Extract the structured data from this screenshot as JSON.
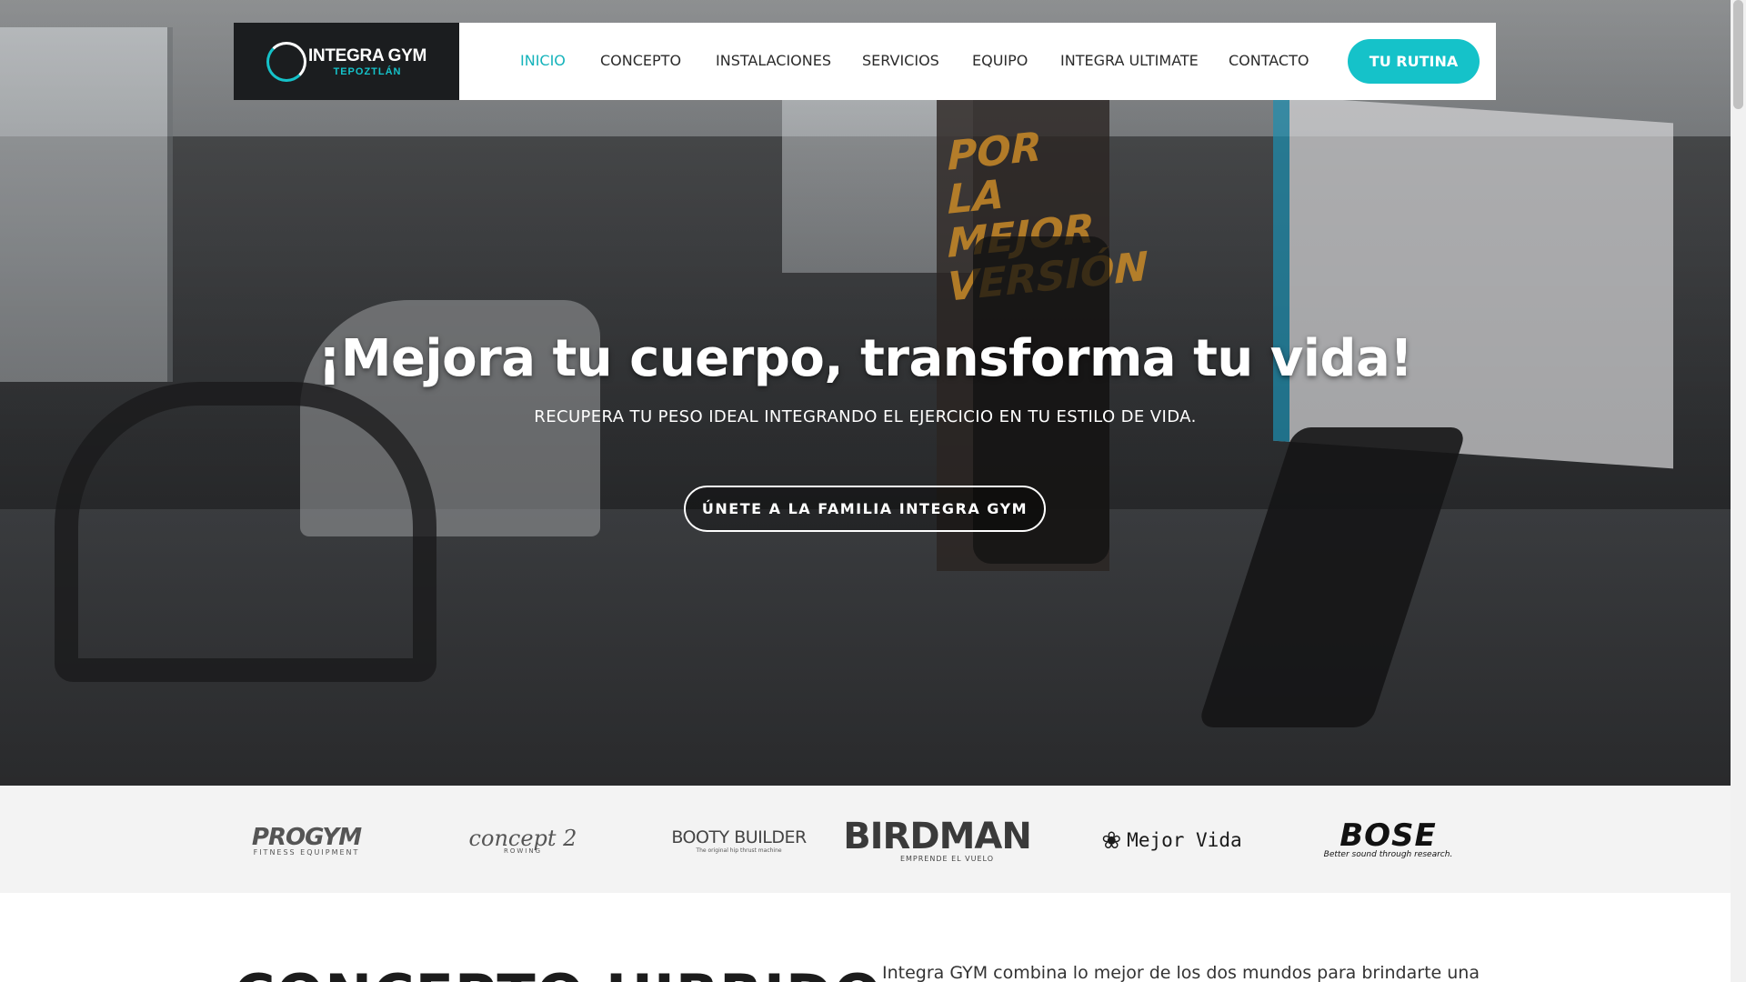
{
  "header": {
    "logo": {
      "name": "INTEGRA GYM",
      "subtitle": "TEPOZTLÁN",
      "icon": "ring-logo-icon"
    },
    "nav": [
      {
        "label": "INICIO",
        "active": true
      },
      {
        "label": "CONCEPTO",
        "active": false
      },
      {
        "label": "INSTALACIONES",
        "active": false
      },
      {
        "label": "SERVICIOS",
        "active": false
      },
      {
        "label": "EQUIPO",
        "active": false
      },
      {
        "label": "INTEGRA ULTIMATE",
        "active": false
      },
      {
        "label": "CONTACTO",
        "active": false
      }
    ],
    "cta_label": "TU RUTINA"
  },
  "hero": {
    "title": "¡Mejora tu cuerpo, transforma tu vida!",
    "subtitle": "RECUPERA TU PESO IDEAL INTEGRANDO EL EJERCICIO EN TU ESTILO DE VIDA.",
    "cta_label": "ÚNETE A LA FAMILIA INTEGRA GYM",
    "poster_text": "POR LA MEJOR VERSIÓN"
  },
  "brands": [
    {
      "name": "PROGYM",
      "tagline": "FITNESS EQUIPMENT"
    },
    {
      "name": "concept 2",
      "tagline": "ROWING"
    },
    {
      "name": "BOOTY BUILDER",
      "tagline": "The original hip thrust machine"
    },
    {
      "name": "BIRDMAN",
      "tagline": "EMPRENDE EL VUELO"
    },
    {
      "name": "Mejor Vida",
      "tagline": ""
    },
    {
      "name": "BOSE",
      "tagline": "Better sound through research."
    }
  ],
  "concept": {
    "heading": "CONCEPTO HIBRIDO",
    "text": "Integra GYM combina lo mejor de los dos mundos para brindarte una"
  },
  "colors": {
    "accent": "#15c2c9",
    "logo_bg": "#1b1d1f",
    "nav_text": "#2b2b2b",
    "brands_bg": "#f3f3f3"
  }
}
